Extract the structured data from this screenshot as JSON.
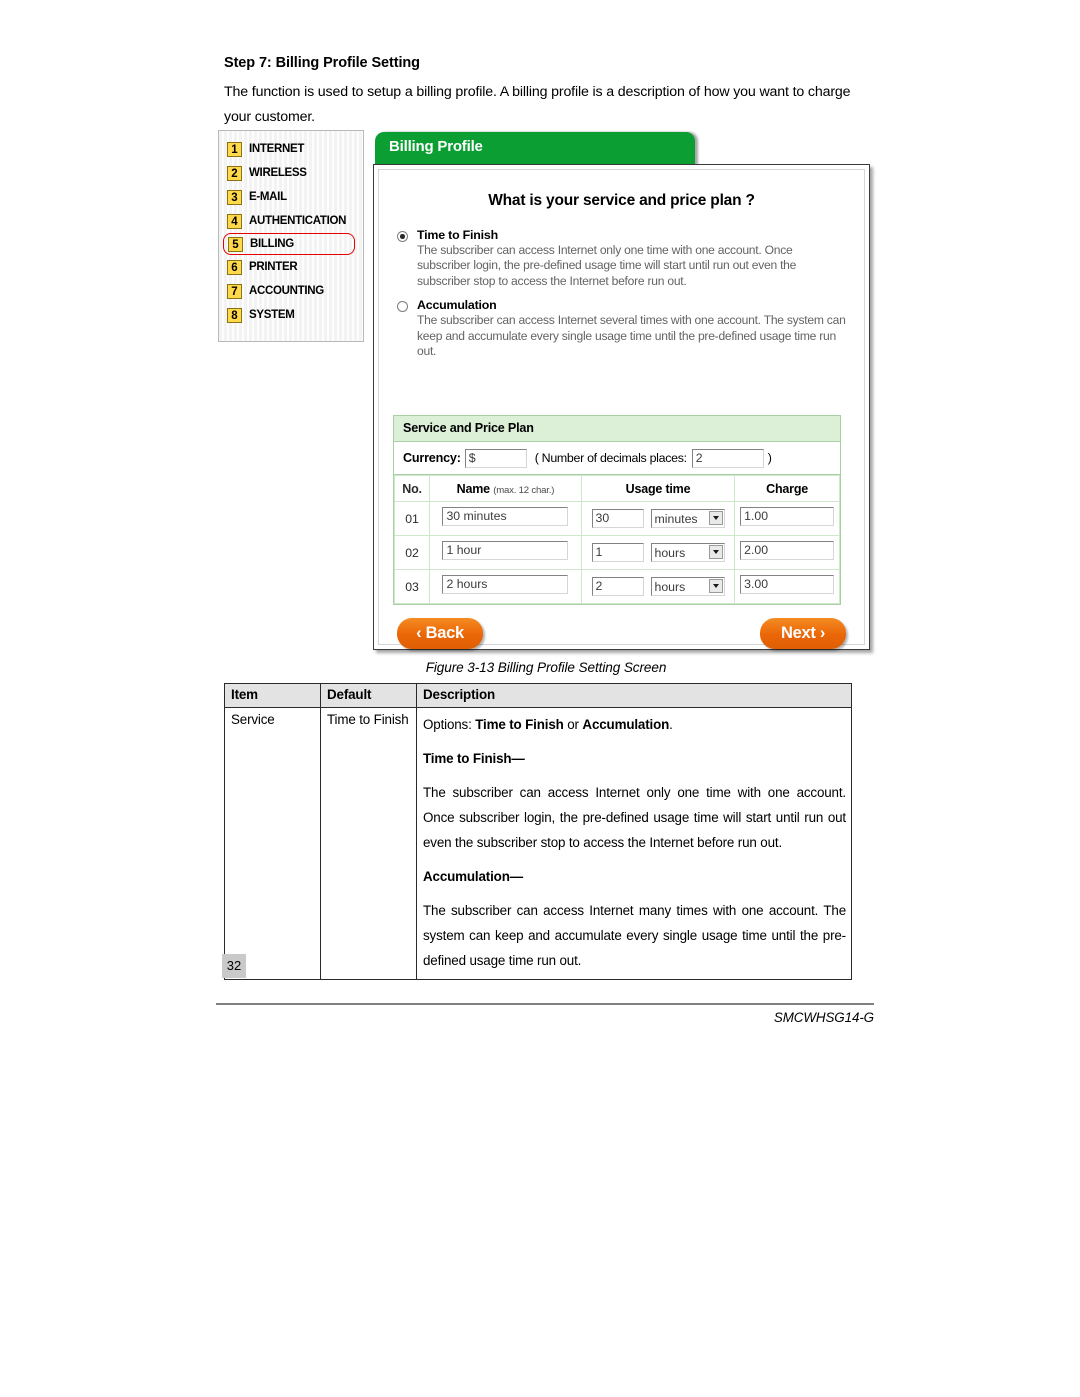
{
  "document": {
    "step_title": "Step 7: Billing Profile Setting",
    "intro": "The function is used to setup a billing profile. A billing profile is a description of how you want to charge your customer.",
    "figure_caption": "Figure 3-13 Billing Profile Setting Screen",
    "page_number": "32",
    "doc_id": "SMCWHSG14-G"
  },
  "screenshot": {
    "nav": {
      "items": [
        {
          "num": "1",
          "label": "INTERNET",
          "selected": false
        },
        {
          "num": "2",
          "label": "WIRELESS",
          "selected": false
        },
        {
          "num": "3",
          "label": "E-MAIL",
          "selected": false
        },
        {
          "num": "4",
          "label": "AUTHENTICATION",
          "selected": false
        },
        {
          "num": "5",
          "label": "BILLING",
          "selected": true
        },
        {
          "num": "6",
          "label": "PRINTER",
          "selected": false
        },
        {
          "num": "7",
          "label": "ACCOUNTING",
          "selected": false
        },
        {
          "num": "8",
          "label": "SYSTEM",
          "selected": false
        }
      ]
    },
    "tab_label": "Billing Profile",
    "question": "What is your service and price plan ?",
    "options": [
      {
        "title": "Time to Finish",
        "selected": true,
        "description": "The subscriber can access Internet only one time with one account. Once subscriber login, the pre-defined usage time will start until run out even the subscriber stop to access the Internet before run out."
      },
      {
        "title": "Accumulation",
        "selected": false,
        "description": "The subscriber can access Internet several times with one account. The system can keep and accumulate every single usage time until the pre-defined usage time run out."
      }
    ],
    "service_price_plan": {
      "section_label": "Service and Price Plan",
      "currency_label": "Currency:",
      "currency_value": "$",
      "decimals_prefix": "( Number of decimals places:",
      "decimals_value": "2",
      "decimals_suffix": ")",
      "columns": {
        "no": "No.",
        "name": "Name",
        "name_hint": "(max. 12 char.)",
        "usage_time": "Usage time",
        "charge": "Charge"
      },
      "rows": [
        {
          "no": "01",
          "name": "30 minutes",
          "qty": "30",
          "unit": "minutes",
          "charge": "1.00"
        },
        {
          "no": "02",
          "name": "1 hour",
          "qty": "1",
          "unit": "hours",
          "charge": "2.00"
        },
        {
          "no": "03",
          "name": "2 hours",
          "qty": "2",
          "unit": "hours",
          "charge": "3.00"
        }
      ]
    },
    "buttons": {
      "back": "‹ Back",
      "next": "Next ›"
    },
    "colors": {
      "tab_green": "#0a9e33",
      "badge_yellow": "#ffd94a",
      "selection_red": "#e60000",
      "button_orange": "#ef7010",
      "section_green": "#dcf0d8"
    }
  },
  "description_table": {
    "headers": {
      "item": "Item",
      "default": "Default",
      "description": "Description"
    },
    "row": {
      "item": "Service",
      "default": "Time to Finish",
      "options_line_prefix": "Options: ",
      "options_bold_1": "Time to Finish",
      "options_middle": " or ",
      "options_bold_2": "Accumulation",
      "options_suffix": ".",
      "ttf_heading": "Time to Finish—",
      "ttf_text": "The subscriber can access Internet only one time with one account. Once subscriber login, the pre-defined usage time will start until run out even the subscriber stop to access the Internet before run out.",
      "acc_heading": "Accumulation—",
      "acc_text": "The subscriber can access Internet many times with one account. The system can keep and accumulate every single usage time until the pre-defined usage time run out."
    }
  }
}
